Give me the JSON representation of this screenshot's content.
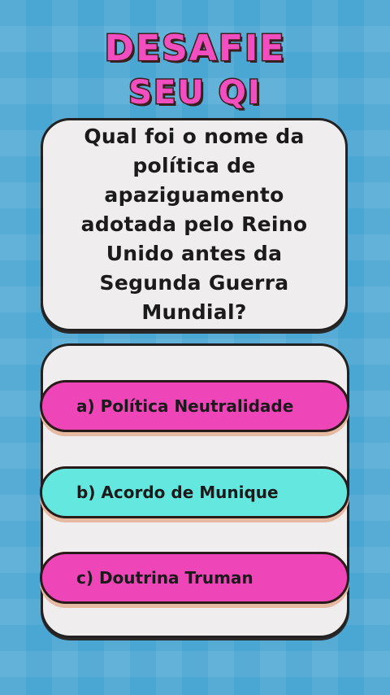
{
  "header": {
    "title_line1": "DESAFIE",
    "title_line2": "SEU QI"
  },
  "question": {
    "text": "Qual foi o nome da política de apaziguamento adotada pelo Reino Unido antes da Segunda Guerra Mundial?"
  },
  "options": [
    {
      "label": "a) Política Neutralidade",
      "color": "#ee45b8"
    },
    {
      "label": "b) Acordo de Munique",
      "color": "#63e7df"
    },
    {
      "label": "c) Doutrina Truman",
      "color": "#ee45b8"
    }
  ],
  "colors": {
    "background": "#4aa6d3",
    "title": "#f14fbf",
    "card": "#efeded"
  }
}
